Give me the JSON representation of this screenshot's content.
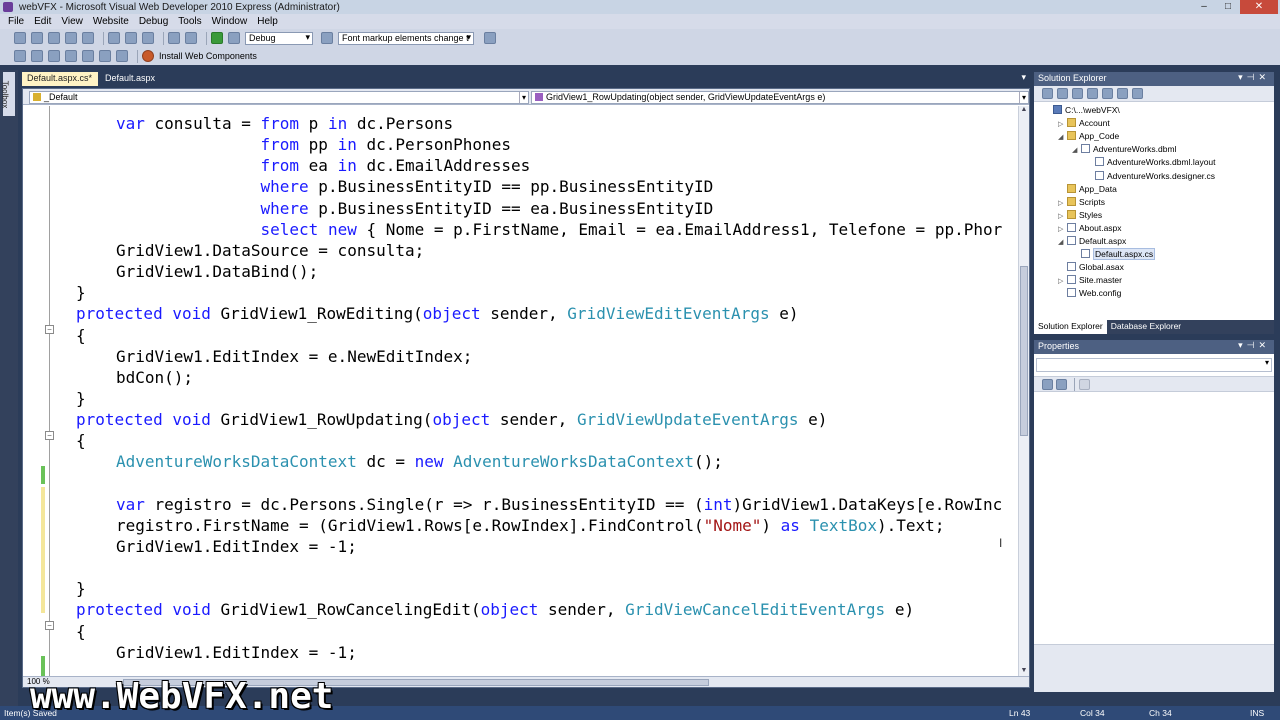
{
  "window": {
    "title": "webVFX - Microsoft Visual Web Developer 2010 Express (Administrator)",
    "controls": [
      "‒",
      "□",
      "✕"
    ]
  },
  "menu": [
    "File",
    "Edit",
    "View",
    "Website",
    "Debug",
    "Tools",
    "Window",
    "Help"
  ],
  "toolbar": {
    "config": "Debug",
    "markup_combo": "Font markup elements change t",
    "install_label": "Install Web Components"
  },
  "toolbox_label": "Toolbox",
  "doc_tabs": [
    {
      "label": "Default.aspx.cs*",
      "active": true
    },
    {
      "label": "Default.aspx",
      "active": false
    }
  ],
  "navbar": {
    "class_combo": "_Default",
    "member_combo": "GridView1_RowUpdating(object sender, GridViewUpdateEventArgs e)"
  },
  "code_lines": [
    {
      "indent": 1,
      "tokens": [
        [
          "kw",
          "var"
        ],
        [
          "",
          " consulta = "
        ],
        [
          "kw",
          "from"
        ],
        [
          "",
          " p "
        ],
        [
          "kw",
          "in"
        ],
        [
          "",
          " dc.Persons"
        ]
      ]
    },
    {
      "indent": 1,
      "tokens": [
        [
          "",
          "               "
        ],
        [
          "kw",
          "from"
        ],
        [
          "",
          " pp "
        ],
        [
          "kw",
          "in"
        ],
        [
          "",
          " dc.PersonPhones"
        ]
      ]
    },
    {
      "indent": 1,
      "tokens": [
        [
          "",
          "               "
        ],
        [
          "kw",
          "from"
        ],
        [
          "",
          " ea "
        ],
        [
          "kw",
          "in"
        ],
        [
          "",
          " dc.EmailAddresses"
        ]
      ]
    },
    {
      "indent": 1,
      "tokens": [
        [
          "",
          "               "
        ],
        [
          "kw",
          "where"
        ],
        [
          "",
          " p.BusinessEntityID == pp.BusinessEntityID"
        ]
      ]
    },
    {
      "indent": 1,
      "tokens": [
        [
          "",
          "               "
        ],
        [
          "kw",
          "where"
        ],
        [
          "",
          " p.BusinessEntityID == ea.BusinessEntityID"
        ]
      ]
    },
    {
      "indent": 1,
      "tokens": [
        [
          "",
          "               "
        ],
        [
          "kw",
          "select"
        ],
        [
          "",
          " "
        ],
        [
          "kw",
          "new"
        ],
        [
          "",
          " { Nome = p.FirstName, Email = ea.EmailAddress1, Telefone = pp.Phor"
        ]
      ]
    },
    {
      "indent": 1,
      "tokens": [
        [
          "",
          "GridView1.DataSource = consulta;"
        ]
      ]
    },
    {
      "indent": 1,
      "tokens": [
        [
          "",
          "GridView1.DataBind();"
        ]
      ]
    },
    {
      "indent": 0,
      "tokens": [
        [
          "",
          "}"
        ]
      ]
    },
    {
      "indent": 0,
      "tokens": [
        [
          "kw",
          "protected"
        ],
        [
          "",
          " "
        ],
        [
          "kw",
          "void"
        ],
        [
          "",
          " GridView1_RowEditing("
        ],
        [
          "kw",
          "object"
        ],
        [
          "",
          " sender, "
        ],
        [
          "ty",
          "GridViewEditEventArgs"
        ],
        [
          "",
          " e)"
        ]
      ]
    },
    {
      "indent": 0,
      "tokens": [
        [
          "",
          "{"
        ]
      ]
    },
    {
      "indent": 1,
      "tokens": [
        [
          "",
          "GridView1.EditIndex = e.NewEditIndex;"
        ]
      ]
    },
    {
      "indent": 1,
      "tokens": [
        [
          "",
          "bdCon();"
        ]
      ]
    },
    {
      "indent": 0,
      "tokens": [
        [
          "",
          "}"
        ]
      ]
    },
    {
      "indent": 0,
      "tokens": [
        [
          "kw",
          "protected"
        ],
        [
          "",
          " "
        ],
        [
          "kw",
          "void"
        ],
        [
          "",
          " GridView1_RowUpdating("
        ],
        [
          "kw",
          "object"
        ],
        [
          "",
          " sender, "
        ],
        [
          "ty",
          "GridViewUpdateEventArgs"
        ],
        [
          "",
          " e)"
        ]
      ]
    },
    {
      "indent": 0,
      "tokens": [
        [
          "",
          "{"
        ]
      ]
    },
    {
      "indent": 1,
      "tokens": [
        [
          "ty",
          "AdventureWorksDataContext"
        ],
        [
          "",
          " dc = "
        ],
        [
          "kw",
          "new"
        ],
        [
          "",
          " "
        ],
        [
          "ty",
          "AdventureWorksDataContext"
        ],
        [
          "",
          "();"
        ]
      ]
    },
    {
      "indent": 0,
      "tokens": [
        [
          "",
          ""
        ]
      ]
    },
    {
      "indent": 1,
      "tokens": [
        [
          "kw",
          "var"
        ],
        [
          "",
          " registro = dc.Persons.Single(r => r.BusinessEntityID == ("
        ],
        [
          "kw",
          "int"
        ],
        [
          "",
          ")GridView1.DataKeys[e.RowInc"
        ]
      ]
    },
    {
      "indent": 1,
      "tokens": [
        [
          "",
          "registro.FirstName = (GridView1.Rows[e.RowIndex].FindControl("
        ],
        [
          "st",
          "\"Nome\""
        ],
        [
          "",
          ") "
        ],
        [
          "kw",
          "as"
        ],
        [
          "",
          " "
        ],
        [
          "ty",
          "TextBox"
        ],
        [
          "",
          ").Text;"
        ]
      ]
    },
    {
      "indent": 1,
      "tokens": [
        [
          "",
          "GridView1.EditIndex = -1;"
        ]
      ]
    },
    {
      "indent": 0,
      "tokens": [
        [
          "",
          ""
        ]
      ]
    },
    {
      "indent": 0,
      "tokens": [
        [
          "",
          "}"
        ]
      ]
    },
    {
      "indent": 0,
      "tokens": [
        [
          "kw",
          "protected"
        ],
        [
          "",
          " "
        ],
        [
          "kw",
          "void"
        ],
        [
          "",
          " GridView1_RowCancelingEdit("
        ],
        [
          "kw",
          "object"
        ],
        [
          "",
          " sender, "
        ],
        [
          "ty",
          "GridViewCancelEditEventArgs"
        ],
        [
          "",
          " e)"
        ]
      ]
    },
    {
      "indent": 0,
      "tokens": [
        [
          "",
          "{"
        ]
      ]
    },
    {
      "indent": 1,
      "tokens": [
        [
          "",
          "GridView1.EditIndex = -1;"
        ]
      ]
    }
  ],
  "zoom": "100 %",
  "solution_explorer": {
    "title": "Solution Explorer",
    "items": [
      {
        "label": "C:\\...\\webVFX\\",
        "level": 0,
        "exp": "",
        "icon": "proj",
        "selected": false
      },
      {
        "label": "Account",
        "level": 1,
        "exp": "▷",
        "icon": "folder",
        "selected": false
      },
      {
        "label": "App_Code",
        "level": 1,
        "exp": "◢",
        "icon": "folder",
        "selected": false
      },
      {
        "label": "AdventureWorks.dbml",
        "level": 2,
        "exp": "◢",
        "icon": "file",
        "selected": false
      },
      {
        "label": "AdventureWorks.dbml.layout",
        "level": 3,
        "exp": "",
        "icon": "file",
        "selected": false
      },
      {
        "label": "AdventureWorks.designer.cs",
        "level": 3,
        "exp": "",
        "icon": "file",
        "selected": false
      },
      {
        "label": "App_Data",
        "level": 1,
        "exp": "",
        "icon": "folder",
        "selected": false
      },
      {
        "label": "Scripts",
        "level": 1,
        "exp": "▷",
        "icon": "folder",
        "selected": false
      },
      {
        "label": "Styles",
        "level": 1,
        "exp": "▷",
        "icon": "folder",
        "selected": false
      },
      {
        "label": "About.aspx",
        "level": 1,
        "exp": "▷",
        "icon": "file",
        "selected": false
      },
      {
        "label": "Default.aspx",
        "level": 1,
        "exp": "◢",
        "icon": "file",
        "selected": false
      },
      {
        "label": "Default.aspx.cs",
        "level": 2,
        "exp": "",
        "icon": "file",
        "selected": true
      },
      {
        "label": "Global.asax",
        "level": 1,
        "exp": "",
        "icon": "file",
        "selected": false
      },
      {
        "label": "Site.master",
        "level": 1,
        "exp": "▷",
        "icon": "file",
        "selected": false
      },
      {
        "label": "Web.config",
        "level": 1,
        "exp": "",
        "icon": "file",
        "selected": false
      }
    ],
    "tabs": [
      {
        "label": "Solution Explorer",
        "active": true
      },
      {
        "label": "Database Explorer",
        "active": false
      }
    ]
  },
  "properties": {
    "title": "Properties"
  },
  "statusbar": {
    "left": "Item(s) Saved",
    "ln": "Ln 43",
    "col": "Col 34",
    "ch": "Ch 34",
    "mode": "INS"
  },
  "watermark": "www.WebVFX.net"
}
